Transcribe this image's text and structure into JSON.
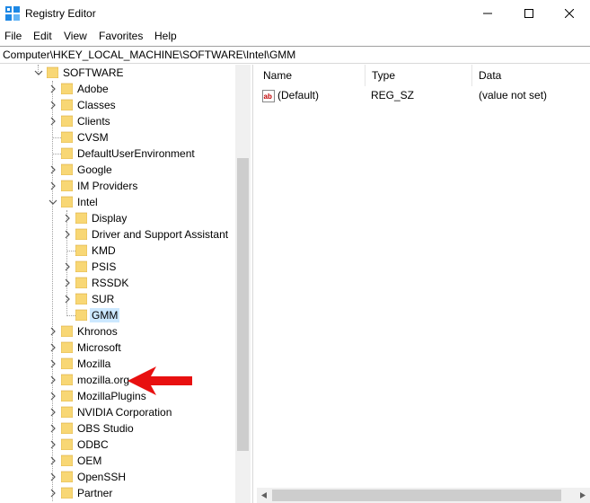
{
  "window": {
    "title": "Registry Editor",
    "controls": {
      "minimize": "minimize-icon",
      "maximize": "maximize-icon",
      "close": "close-icon"
    }
  },
  "menu": [
    "File",
    "Edit",
    "View",
    "Favorites",
    "Help"
  ],
  "address": {
    "path": "Computer\\HKEY_LOCAL_MACHINE\\SOFTWARE\\Intel\\GMM"
  },
  "tree": {
    "items": [
      {
        "label": "SOFTWARE",
        "expanded": true,
        "has_children": true
      },
      {
        "label": "Adobe",
        "has_children": true
      },
      {
        "label": "Classes",
        "has_children": true
      },
      {
        "label": "Clients",
        "has_children": true
      },
      {
        "label": "CVSM",
        "has_children": false
      },
      {
        "label": "DefaultUserEnvironment",
        "has_children": false
      },
      {
        "label": "Google",
        "has_children": true
      },
      {
        "label": "IM Providers",
        "has_children": true
      },
      {
        "label": "Intel",
        "expanded": true,
        "has_children": true
      },
      {
        "label": "Display",
        "has_children": true
      },
      {
        "label": "Driver and Support Assistant",
        "has_children": true
      },
      {
        "label": "KMD",
        "has_children": false
      },
      {
        "label": "PSIS",
        "has_children": true
      },
      {
        "label": "RSSDK",
        "has_children": true
      },
      {
        "label": "SUR",
        "has_children": true
      },
      {
        "label": "GMM",
        "has_children": false,
        "selected": true
      },
      {
        "label": "Khronos",
        "has_children": true
      },
      {
        "label": "Microsoft",
        "has_children": true
      },
      {
        "label": "Mozilla",
        "has_children": true
      },
      {
        "label": "mozilla.org",
        "has_children": true
      },
      {
        "label": "MozillaPlugins",
        "has_children": true
      },
      {
        "label": "NVIDIA Corporation",
        "has_children": true
      },
      {
        "label": "OBS Studio",
        "has_children": true
      },
      {
        "label": "ODBC",
        "has_children": true
      },
      {
        "label": "OEM",
        "has_children": true
      },
      {
        "label": "OpenSSH",
        "has_children": true
      },
      {
        "label": "Partner",
        "has_children": true
      }
    ]
  },
  "list": {
    "columns": [
      "Name",
      "Type",
      "Data"
    ],
    "rows": [
      {
        "name": "(Default)",
        "type": "REG_SZ",
        "data": "(value not set)",
        "icon": "string-value-icon"
      }
    ]
  },
  "colors": {
    "selection": "#cce8ff",
    "folder": "#f8d775",
    "annotation_arrow": "#e81010"
  }
}
